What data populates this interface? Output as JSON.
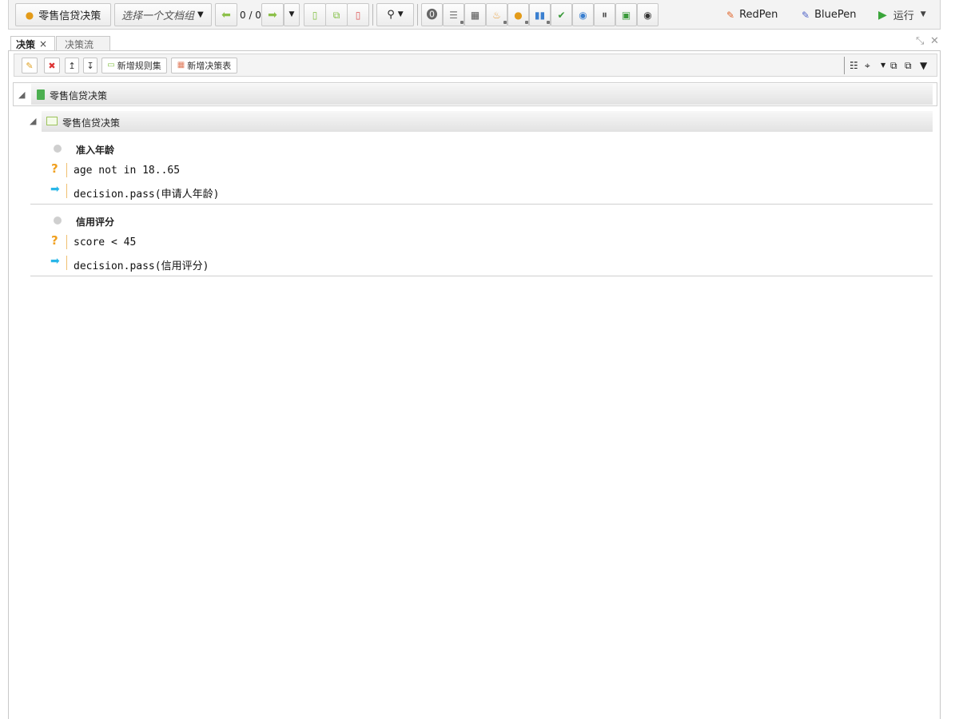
{
  "toolbar": {
    "project": "零售信贷决策",
    "doc_group_placeholder": "选择一个文档组",
    "page_counter": "0 / 0",
    "red_pen": "RedPen",
    "blue_pen": "BluePen",
    "run": "运行"
  },
  "tabs": [
    {
      "label": "决策",
      "close": "×"
    },
    {
      "label": "决策流"
    }
  ],
  "subtoolbar": {
    "add_ruleset": "新增规则集",
    "add_decision_table": "新增决策表"
  },
  "tree": {
    "root_label": "零售信贷决策",
    "ruleset_label": "零售信贷决策",
    "rules": [
      {
        "title": "准入年龄",
        "condition": "age not in 18..65",
        "action": "decision.pass(申请人年龄)"
      },
      {
        "title": "信用评分",
        "condition": "score < 45",
        "action": "decision.pass(信用评分)"
      }
    ]
  },
  "colors": {
    "condition_icon": "#f0a020",
    "action_icon": "#29b6e8",
    "run_icon": "#3aa53a",
    "delete_icon": "#d33"
  }
}
